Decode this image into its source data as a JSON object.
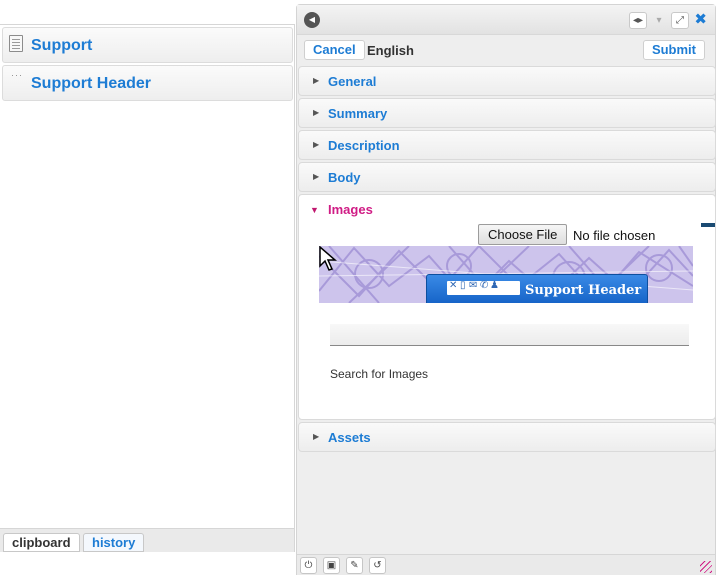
{
  "left_panel": {
    "items": [
      {
        "label": "Support",
        "icon": "document-icon"
      },
      {
        "label": "Support Header",
        "icon": "dots-icon"
      }
    ],
    "bottom_tabs": [
      {
        "label": "clipboard",
        "active": true
      },
      {
        "label": "history",
        "active": false
      }
    ]
  },
  "editor": {
    "title_buttons": [
      "back-icon",
      "expand-horizontal-icon",
      "pin-icon",
      "fullscreen-icon",
      "close-icon"
    ],
    "cancel_label": "Cancel",
    "language": "English",
    "submit_label": "Submit",
    "sections": {
      "general": "General",
      "summary": "Summary",
      "description": "Description",
      "body": "Body",
      "images": "Images",
      "assets": "Assets"
    },
    "images": {
      "choose_file_label": "Choose File",
      "file_status": "No file chosen",
      "header_image_text": "Support Header",
      "search_label": "Search for Images"
    },
    "bottom_buttons": [
      "power-icon",
      "lock-icon",
      "edit-icon",
      "undo-icon"
    ]
  },
  "colors": {
    "link_blue": "#1d7cd4",
    "active_magenta": "#d01c85",
    "header_blue": "#1462c6"
  }
}
